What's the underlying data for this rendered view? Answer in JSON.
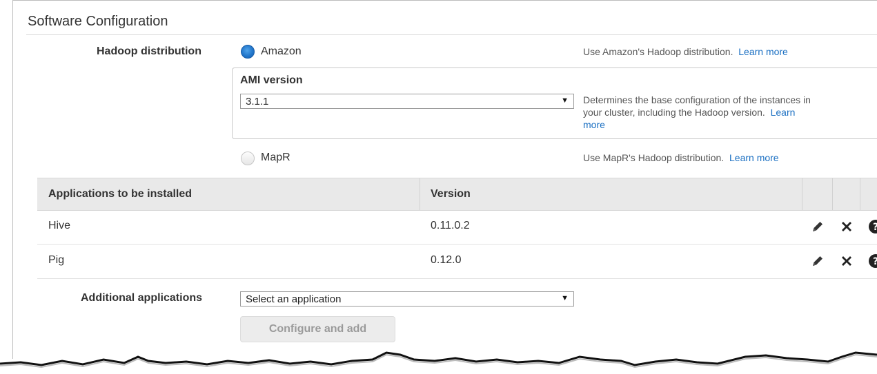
{
  "section": {
    "title": "Software Configuration"
  },
  "hadoop": {
    "label": "Hadoop distribution",
    "amazon": {
      "label": "Amazon",
      "selected": true,
      "help": "Use Amazon's Hadoop distribution.",
      "link": "Learn more"
    },
    "ami": {
      "label": "AMI version",
      "value": "3.1.1",
      "help_line1": "Determines the base configuration of the instances in",
      "help_line2": "your cluster, including the Hadoop version.",
      "link_part1": "Learn",
      "link_part2": "more"
    },
    "mapr": {
      "label": "MapR",
      "selected": false,
      "help": "Use MapR's Hadoop distribution.",
      "link": "Learn more"
    }
  },
  "apps_table": {
    "headers": [
      "Applications to be installed",
      "Version"
    ],
    "rows": [
      {
        "name": "Hive",
        "version": "0.11.0.2"
      },
      {
        "name": "Pig",
        "version": "0.12.0"
      }
    ]
  },
  "additional": {
    "label": "Additional applications",
    "select_value": "Select an application",
    "button": "Configure and add"
  },
  "icons": [
    "pencil-icon",
    "close-icon",
    "help-icon"
  ],
  "colors": {
    "accent": "#1a6fc2",
    "radio_on": "#1f73c8",
    "header_bg": "#e9e9e9"
  }
}
